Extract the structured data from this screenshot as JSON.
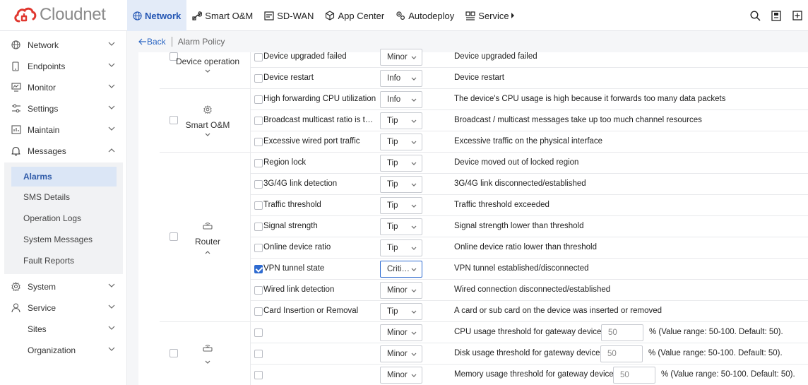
{
  "brand": {
    "name": "Cloudnet",
    "color": "#e0372f"
  },
  "topnav": [
    {
      "label": "Network",
      "icon": "globe-icon",
      "active": true
    },
    {
      "label": "Smart O&M",
      "icon": "wrench-icon"
    },
    {
      "label": "SD-WAN",
      "icon": "sdwan-icon"
    },
    {
      "label": "App Center",
      "icon": "cube-icon"
    },
    {
      "label": "Autodeploy",
      "icon": "gears-icon"
    },
    {
      "label": "Service",
      "icon": "service-icon"
    }
  ],
  "sidebar": {
    "items": [
      {
        "label": "Network",
        "icon": "globe-icon"
      },
      {
        "label": "Endpoints",
        "icon": "phone-icon"
      },
      {
        "label": "Monitor",
        "icon": "monitor-icon"
      },
      {
        "label": "Settings",
        "icon": "sliders-icon"
      },
      {
        "label": "Maintain",
        "icon": "chart-icon"
      },
      {
        "label": "Messages",
        "icon": "bell-icon"
      },
      {
        "label": "System",
        "icon": "gear-icon"
      },
      {
        "label": "Service",
        "icon": "user-icon"
      },
      {
        "label": "Sites",
        "icon": ""
      },
      {
        "label": "Organization",
        "icon": ""
      }
    ],
    "messages_sub": [
      "Alarms",
      "SMS Details",
      "Operation Logs",
      "System Messages",
      "Fault Reports"
    ]
  },
  "breadcrumb": {
    "back": "Back",
    "current": "Alarm Policy"
  },
  "groups": {
    "device_operation": "Device operation",
    "smart_om": "Smart O&M",
    "router": "Router"
  },
  "rows": [
    {
      "name": "Device upgraded failed",
      "level": "Minor",
      "desc": "Device upgraded failed",
      "checked": false
    },
    {
      "name": "Device restart",
      "level": "Info",
      "desc": "Device restart",
      "checked": false
    },
    {
      "name": "High forwarding CPU utilization",
      "level": "Info",
      "desc": "The device's CPU usage is high because it forwards too many data packets",
      "checked": false
    },
    {
      "name": "Broadcast multicast ratio is t…",
      "level": "Tip",
      "desc": "Broadcast / multicast messages take up too much channel resources",
      "checked": false
    },
    {
      "name": "Excessive wired port traffic",
      "level": "Tip",
      "desc": "Excessive traffic on the physical interface",
      "checked": false
    },
    {
      "name": "Region lock",
      "level": "Tip",
      "desc": "Device moved out of locked region",
      "checked": false
    },
    {
      "name": "3G/4G link detection",
      "level": "Tip",
      "desc": "3G/4G link disconnected/established",
      "checked": false
    },
    {
      "name": "Traffic threshold",
      "level": "Tip",
      "desc": "Traffic threshold exceeded",
      "checked": false
    },
    {
      "name": "Signal strength",
      "level": "Tip",
      "desc": "Signal strength lower than threshold",
      "checked": false
    },
    {
      "name": "Online device ratio",
      "level": "Tip",
      "desc": "Online device ratio lower than threshold",
      "checked": false
    },
    {
      "name": "VPN tunnel state",
      "level": "Criti…",
      "desc": "VPN tunnel established/disconnected",
      "checked": true
    },
    {
      "name": "Wired link detection",
      "level": "Minor",
      "desc": "Wired connection disconnected/established",
      "checked": false
    },
    {
      "name": "Card Insertion or Removal",
      "level": "Tip",
      "desc": "A card or sub card on the device was inserted or removed",
      "checked": false
    }
  ],
  "threshold_rows": [
    {
      "level": "Minor",
      "desc": "CPU usage threshold for gateway devices:",
      "value": "50",
      "suffix": "% (Value range: 50-100. Default: 50)."
    },
    {
      "level": "Minor",
      "desc": "Disk usage threshold for gateway devices:",
      "value": "50",
      "suffix": "% (Value range: 50-100. Default: 50)."
    },
    {
      "level": "Minor",
      "desc": "Memory usage threshold for gateway devices:",
      "value": "50",
      "suffix": "% (Value range: 50-100. Default: 50)."
    }
  ]
}
